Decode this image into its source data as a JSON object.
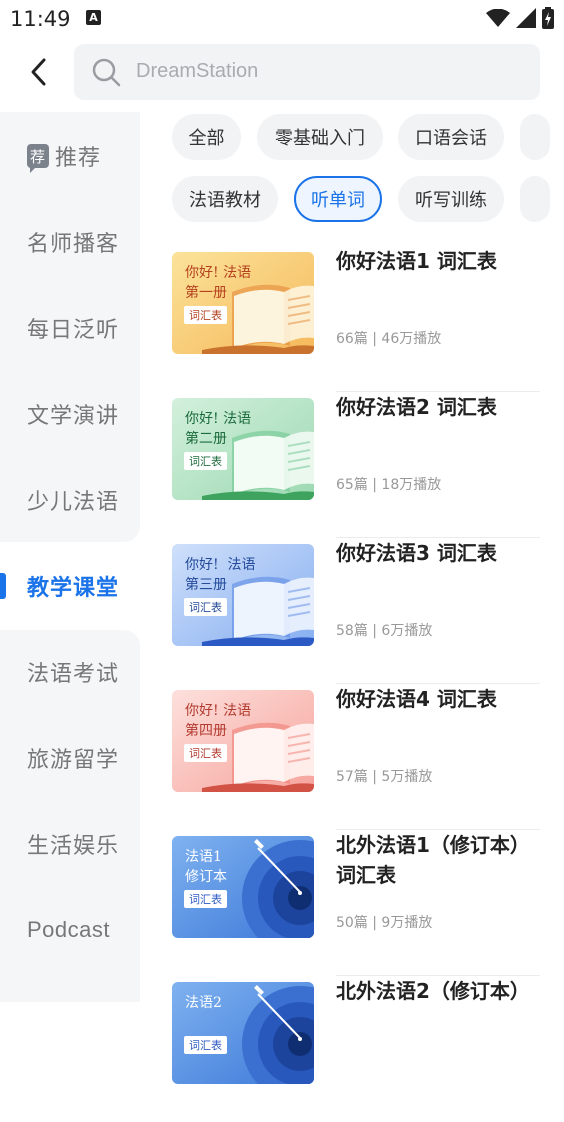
{
  "status": {
    "time": "11:49",
    "notif_letter": "A"
  },
  "search": {
    "placeholder": "DreamStation"
  },
  "sidebar": [
    {
      "label": "推荐",
      "active": false,
      "recommended": true,
      "icon_char": "荐"
    },
    {
      "label": "名师播客",
      "active": false
    },
    {
      "label": "每日泛听",
      "active": false
    },
    {
      "label": "文学演讲",
      "active": false
    },
    {
      "label": "少儿法语",
      "active": false
    },
    {
      "label": "教学课堂",
      "active": true
    },
    {
      "label": "法语考试",
      "active": false
    },
    {
      "label": "旅游留学",
      "active": false
    },
    {
      "label": "生活娱乐",
      "active": false
    },
    {
      "label": "Podcast",
      "active": false
    }
  ],
  "chips_row1": [
    "全部",
    "零基础入门",
    "口语会话"
  ],
  "chips_row2": [
    "法语教材",
    "听单词",
    "听写训练"
  ],
  "active_chip": "听单词",
  "tag_label": "词汇表",
  "items": [
    {
      "title": "你好法语1 词汇表",
      "meta": "66篇 | 46万播放",
      "cover_title": "你好! 法语\n第一册",
      "theme": "orange"
    },
    {
      "title": "你好法语2 词汇表",
      "meta": "65篇 | 18万播放",
      "cover_title": "你好! 法语\n第二册",
      "theme": "green"
    },
    {
      "title": "你好法语3 词汇表",
      "meta": "58篇 | 6万播放",
      "cover_title": "你好!  法语\n第三册",
      "theme": "blue"
    },
    {
      "title": "你好法语4 词汇表",
      "meta": "57篇 | 5万播放",
      "cover_title": "你好! 法语\n第四册",
      "theme": "red"
    },
    {
      "title": "北外法语1（修订本）词汇表",
      "meta": "50篇 | 9万播放",
      "cover_title": "法语1\n修订本",
      "theme": "target"
    },
    {
      "title": "北外法语2（修订本）",
      "meta": "",
      "cover_title": "法语2",
      "theme": "target"
    }
  ],
  "colors": {
    "accent": "#1a73e8"
  }
}
